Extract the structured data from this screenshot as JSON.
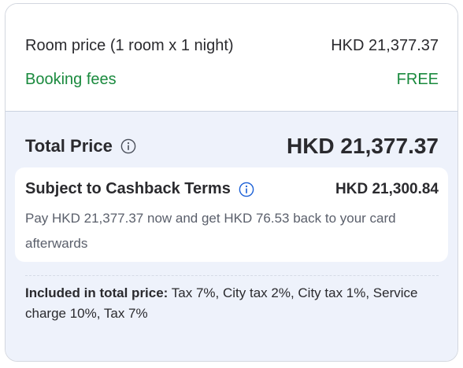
{
  "room": {
    "label": "Room price (1 room x 1 night)",
    "value": "HKD 21,377.37"
  },
  "fees": {
    "label": "Booking fees",
    "value": "FREE"
  },
  "total": {
    "label": "Total Price",
    "value": "HKD 21,377.37"
  },
  "cashback": {
    "title": "Subject to Cashback Terms",
    "amount": "HKD 21,300.84",
    "description": "Pay HKD 21,377.37 now and get HKD 76.53 back to your card afterwards"
  },
  "included": {
    "label": "Included in total price:",
    "text": "Tax 7%, City tax 2%, City tax 1%, Service charge 10%, Tax 7%"
  },
  "colors": {
    "accent_blue": "#1a5fd6",
    "green": "#1a8a3e",
    "panel_bg": "#eef2fb"
  },
  "icons": [
    "info-icon",
    "info-icon-blue"
  ]
}
